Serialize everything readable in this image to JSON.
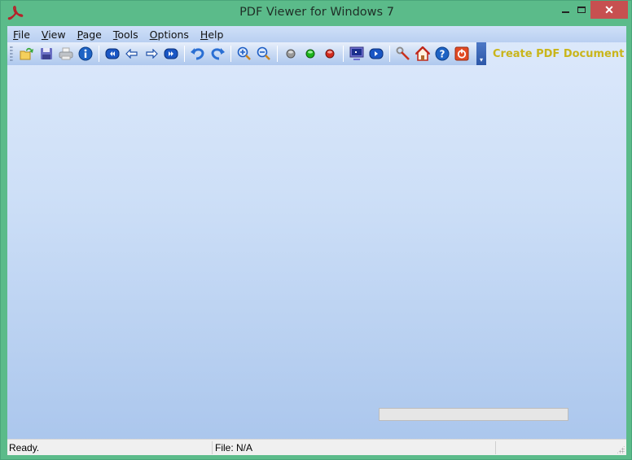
{
  "window": {
    "title": "PDF Viewer for Windows 7",
    "close_label": "✕"
  },
  "menu": [
    {
      "label": "File",
      "accel": "F",
      "rest": "ile"
    },
    {
      "label": "View",
      "accel": "V",
      "rest": "iew"
    },
    {
      "label": "Page",
      "accel": "P",
      "rest": "age"
    },
    {
      "label": "Tools",
      "accel": "T",
      "rest": "ools"
    },
    {
      "label": "Options",
      "accel": "O",
      "rest": "ptions"
    },
    {
      "label": "Help",
      "accel": "H",
      "rest": "elp"
    }
  ],
  "toolbar": {
    "groups": [
      [
        "open-icon",
        "save-icon",
        "print-icon",
        "info-icon"
      ],
      [
        "first-page-icon",
        "previous-page-icon",
        "next-page-icon",
        "last-page-icon"
      ],
      [
        "rotate-left-icon",
        "rotate-right-icon"
      ],
      [
        "zoom-in-icon",
        "zoom-out-icon"
      ],
      [
        "gray-light-icon",
        "green-light-icon",
        "red-light-icon"
      ],
      [
        "fullscreen-icon",
        "slideshow-icon"
      ],
      [
        "settings-wrench-icon",
        "home-icon",
        "help-icon",
        "exit-icon"
      ]
    ],
    "create_link": "Create PDF Document"
  },
  "status": {
    "panel1": "Ready.",
    "panel2": "File: N/A",
    "panel3": ""
  },
  "progress": {
    "value": 0
  }
}
